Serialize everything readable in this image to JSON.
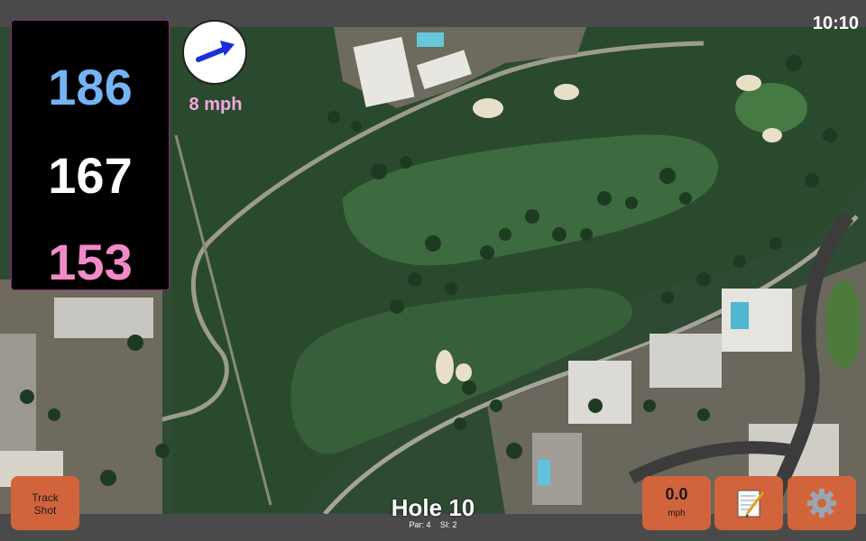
{
  "clock": "10:10",
  "distances": {
    "back": "186",
    "middle": "167",
    "front": "153"
  },
  "wind": {
    "speed_label": "8 mph",
    "direction_icon": "wind-arrow-icon"
  },
  "buttons": {
    "track_shot": "Track\nShot",
    "wind_value": "0.0",
    "wind_unit": "mph",
    "notes_icon": "notepad-icon",
    "settings_icon": "gear-icon"
  },
  "hole": {
    "title": "Hole 10",
    "par": "Par: 4",
    "si": "SI: 2"
  },
  "colors": {
    "back_distance": "#74b4f5",
    "middle_distance": "#ffffff",
    "front_distance": "#f28ac8",
    "button": "#d2643c",
    "wind_label": "#f7a6e0"
  }
}
